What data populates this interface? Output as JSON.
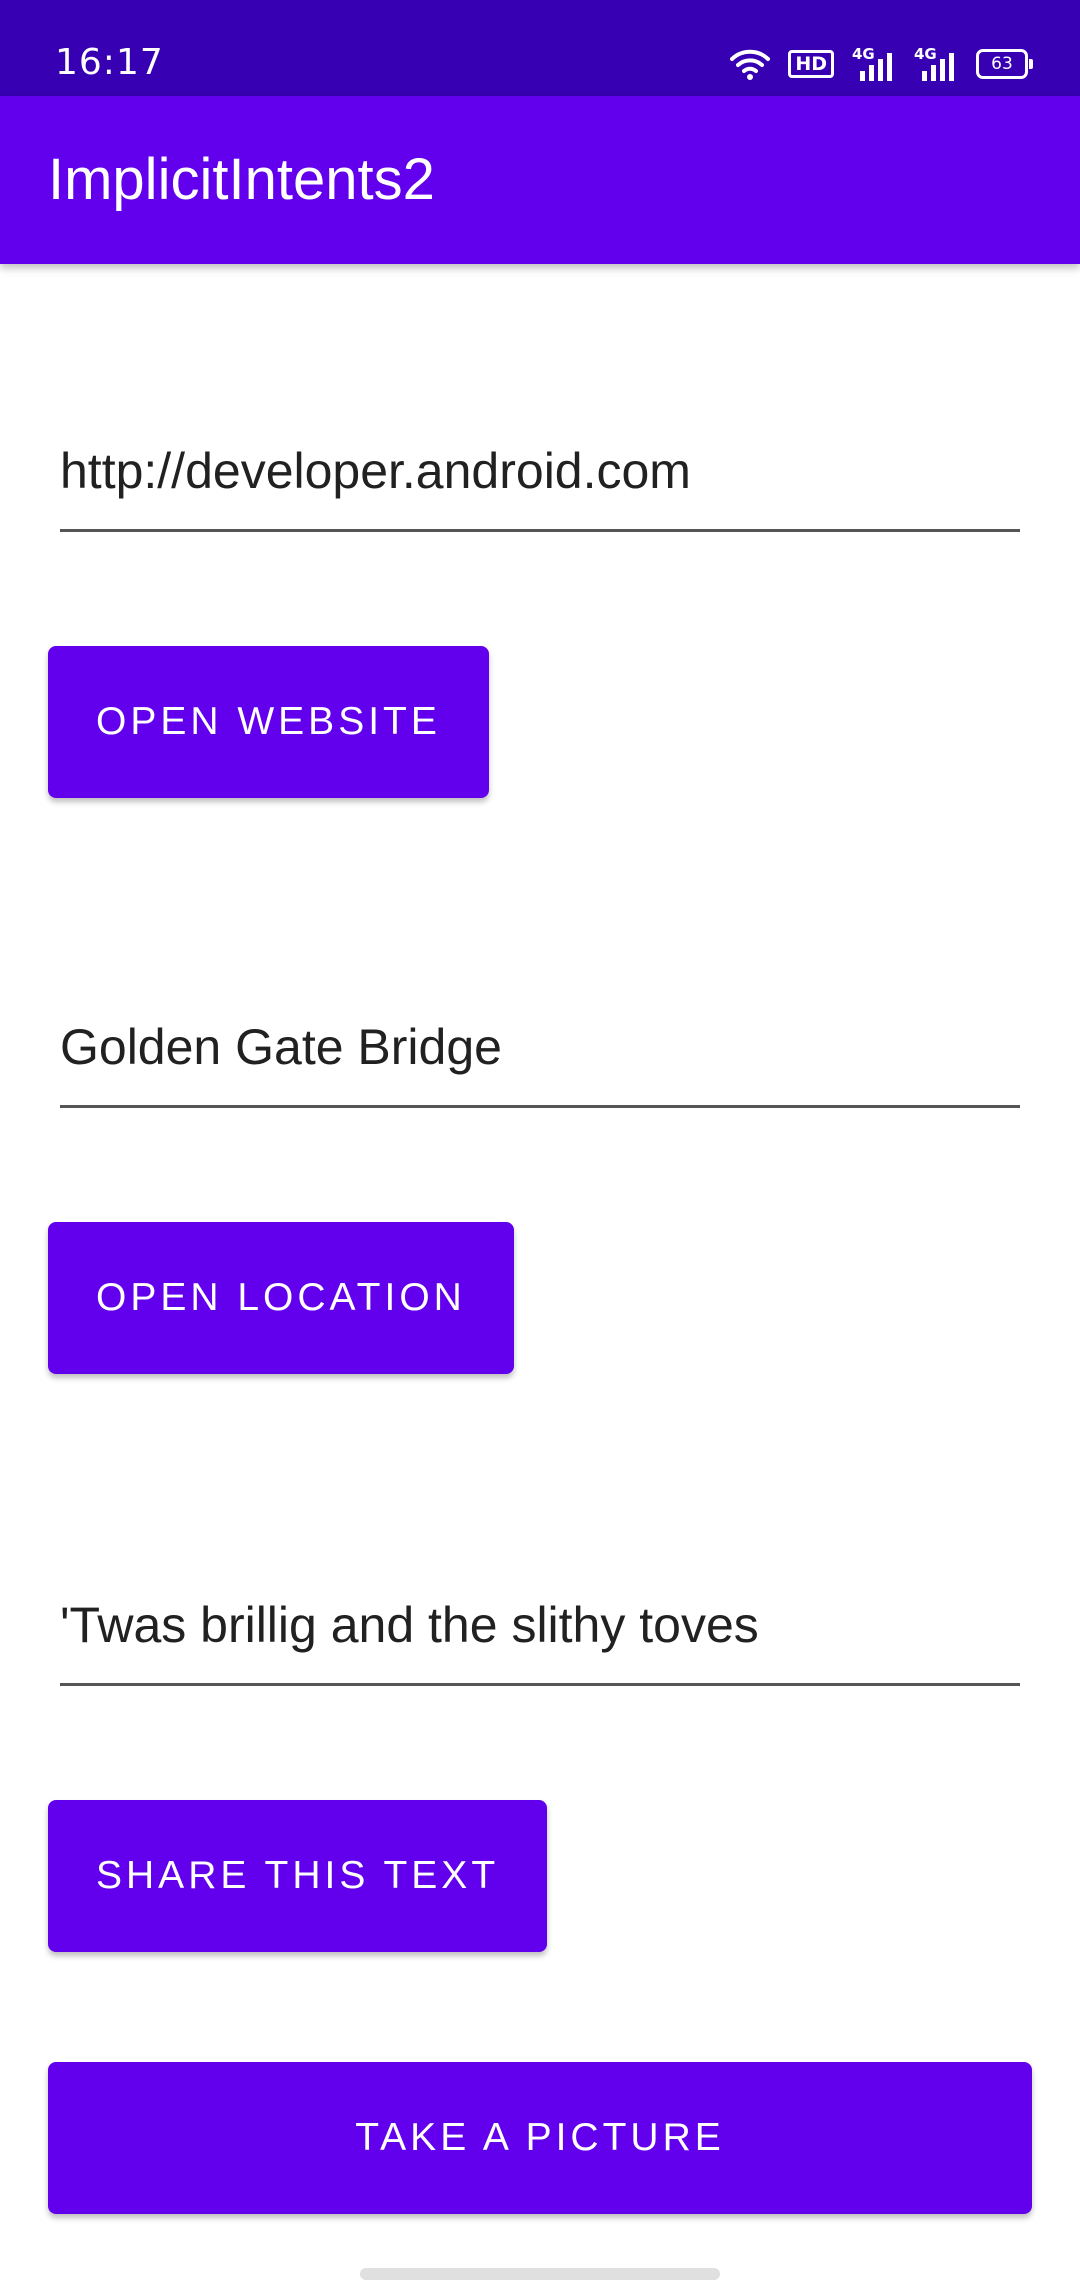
{
  "status_bar": {
    "time": "16:17",
    "hd_badge": "HD",
    "network_1": "4G",
    "network_2": "4G",
    "battery_level": "63",
    "icons": [
      "wifi-icon",
      "hd-icon",
      "signal-icon",
      "signal-icon",
      "battery-icon"
    ]
  },
  "app_bar": {
    "title": "ImplicitIntents2"
  },
  "website": {
    "input_value": "http://developer.android.com",
    "button_label": "Open Website"
  },
  "location": {
    "input_value": "Golden Gate Bridge",
    "button_label": "Open Location"
  },
  "share": {
    "input_value": "'Twas brillig and the slithy toves",
    "button_label": "Share This Text"
  },
  "camera": {
    "button_label": "Take a Picture"
  },
  "colors": {
    "status_bar": "#3700B3",
    "primary": "#6200EE",
    "text": "#212121"
  }
}
